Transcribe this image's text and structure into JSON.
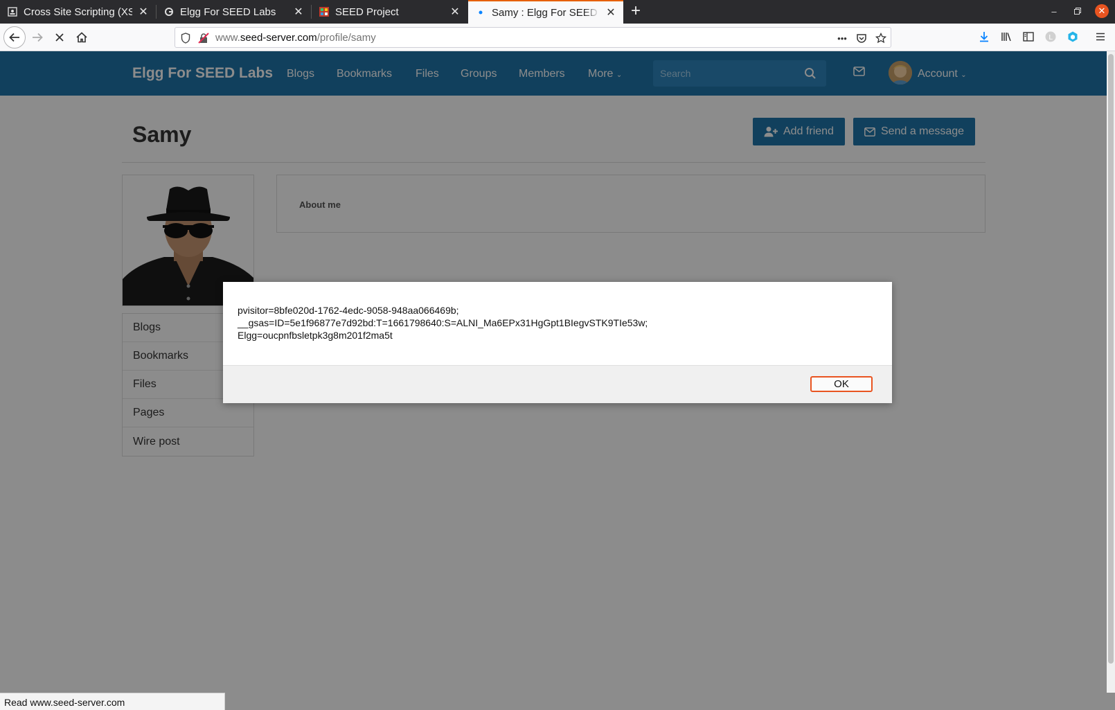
{
  "browser": {
    "tabs": [
      {
        "label": "Cross Site Scripting (XSS)",
        "active": false
      },
      {
        "label": "Elgg For SEED Labs",
        "active": false
      },
      {
        "label": "SEED Project",
        "active": false
      },
      {
        "label": "Samy : Elgg For SEED Labs",
        "active": true
      }
    ],
    "url_prefix": "www.",
    "url_host": "seed-server.com",
    "url_path": "/profile/samy",
    "overflow_label": "•••",
    "status_text": "Read www.seed-server.com"
  },
  "site": {
    "brand": "Elgg For SEED Labs",
    "menu": [
      "Blogs",
      "Bookmarks",
      "Files",
      "Groups",
      "Members",
      "More"
    ],
    "search_placeholder": "Search",
    "account_label": "Account"
  },
  "profile": {
    "name": "Samy",
    "add_friend_label": "Add friend",
    "send_message_label": "Send a message",
    "owner_menu": [
      "Blogs",
      "Bookmarks",
      "Files",
      "Pages",
      "Wire post"
    ],
    "about_label": "About me"
  },
  "alert": {
    "lines": [
      "pvisitor=8bfe020d-1762-4edc-9058-948aa066469b;",
      "__gsas=ID=5e1f96877e7d92bd:T=1661798640:S=ALNI_Ma6EPx31HgGpt1BIegvSTK9TIe53w;",
      "Elgg=oucpnfbsletpk3g8m201f2ma5t"
    ],
    "ok_label": "OK"
  },
  "colors": {
    "elgg_blue": "#1f75a9",
    "firefox_active_tab_accent": "#e66000",
    "ubuntu_orange": "#e95420"
  }
}
